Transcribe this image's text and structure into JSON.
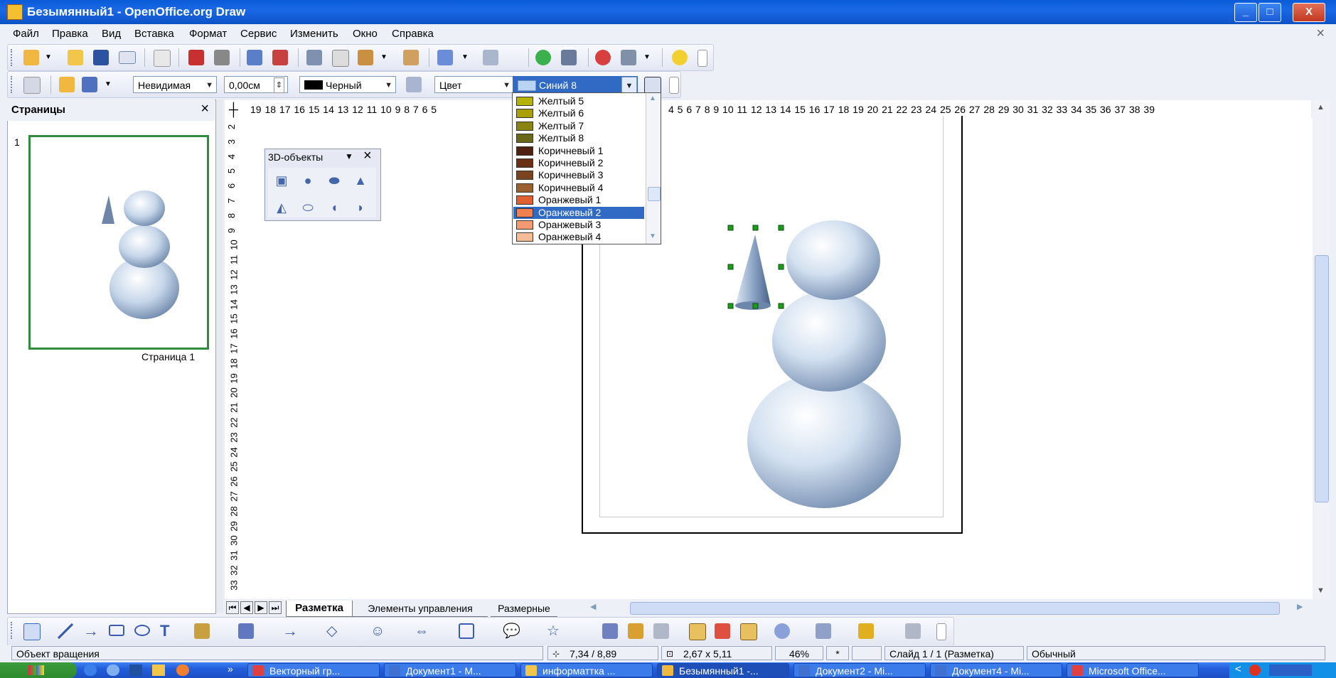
{
  "window": {
    "title": "Безымянный1 - OpenOffice.org Draw",
    "controls": {
      "minimize": "_",
      "maximize": "□",
      "close": "X"
    }
  },
  "menu": {
    "items": [
      "Файл",
      "Правка",
      "Вид",
      "Вставка",
      "Формат",
      "Сервис",
      "Изменить",
      "Окно",
      "Справка"
    ],
    "close": "×"
  },
  "line_toolbar": {
    "line_style": "Невидимая",
    "line_width": "0,00см",
    "line_color": "Черный",
    "area_style": "Цвет",
    "area_color": "Синий 8"
  },
  "color_dropdown": {
    "items": [
      {
        "label": "Желтый 5",
        "color": "#b4b400"
      },
      {
        "label": "Желтый 6",
        "color": "#a8a000"
      },
      {
        "label": "Желтый 7",
        "color": "#8a8410"
      },
      {
        "label": "Желтый 8",
        "color": "#686818"
      },
      {
        "label": "Коричневый 1",
        "color": "#502010"
      },
      {
        "label": "Коричневый 2",
        "color": "#6a3014"
      },
      {
        "label": "Коричневый 3",
        "color": "#7a4420"
      },
      {
        "label": "Коричневый 4",
        "color": "#9a6030"
      },
      {
        "label": "Оранжевый 1",
        "color": "#e06030"
      },
      {
        "label": "Оранжевый 2",
        "color": "#f08050"
      },
      {
        "label": "Оранжевый 3",
        "color": "#f49a70"
      },
      {
        "label": "Оранжевый 4",
        "color": "#f6bc98"
      }
    ],
    "selected_index": 9
  },
  "pages_panel": {
    "title": "Страницы",
    "close": "×",
    "page_number": "1",
    "page_label": "Страница 1"
  },
  "ruler": {
    "h_left": "19 18 17 16 15 14 13 12 11 10  9  8  7  6  5",
    "h_right": "4  5  6  7  8  9  10 11 12 13 14 15 16 17 18 19 20 21 22 23 24 25 26 27 28 29 30 31 32 33 34 35 36 37 38 39",
    "v": [
      "2",
      "3",
      "4",
      "5",
      "6",
      "7",
      "8",
      "9",
      "10",
      "11",
      "12",
      "13",
      "14",
      "15",
      "16",
      "17",
      "18",
      "19",
      "20",
      "21",
      "22",
      "23",
      "24",
      "25",
      "26",
      "27",
      "28",
      "29",
      "30",
      "31",
      "32",
      "33"
    ]
  },
  "toolbar_3d": {
    "title": "3D-объекты",
    "menu": "▼",
    "close": "×",
    "tools": [
      "cube-icon",
      "sphere-icon",
      "cylinder-icon",
      "cone-icon",
      "pyramid-icon",
      "torus-icon",
      "shell-icon",
      "half-sphere-icon"
    ]
  },
  "tabs": {
    "items": [
      "Разметка",
      "Элементы управления",
      "Размерные"
    ],
    "active": 0
  },
  "status": {
    "object": "Объект вращения",
    "position": "7,34 / 8,89",
    "size": "2,67 x 5,11",
    "zoom": "46%",
    "modified": "*",
    "slide": "Слайд 1 / 1 (Разметка)",
    "style": "Обычный"
  },
  "taskbar": {
    "items": [
      "Векторный гр...",
      "Документ1 - М...",
      "информаттка ...",
      "Безымянный1 -...",
      "Документ2 - Mi...",
      "Документ4 - Mi...",
      "Microsoft Office..."
    ],
    "active": 3,
    "more": "»"
  }
}
